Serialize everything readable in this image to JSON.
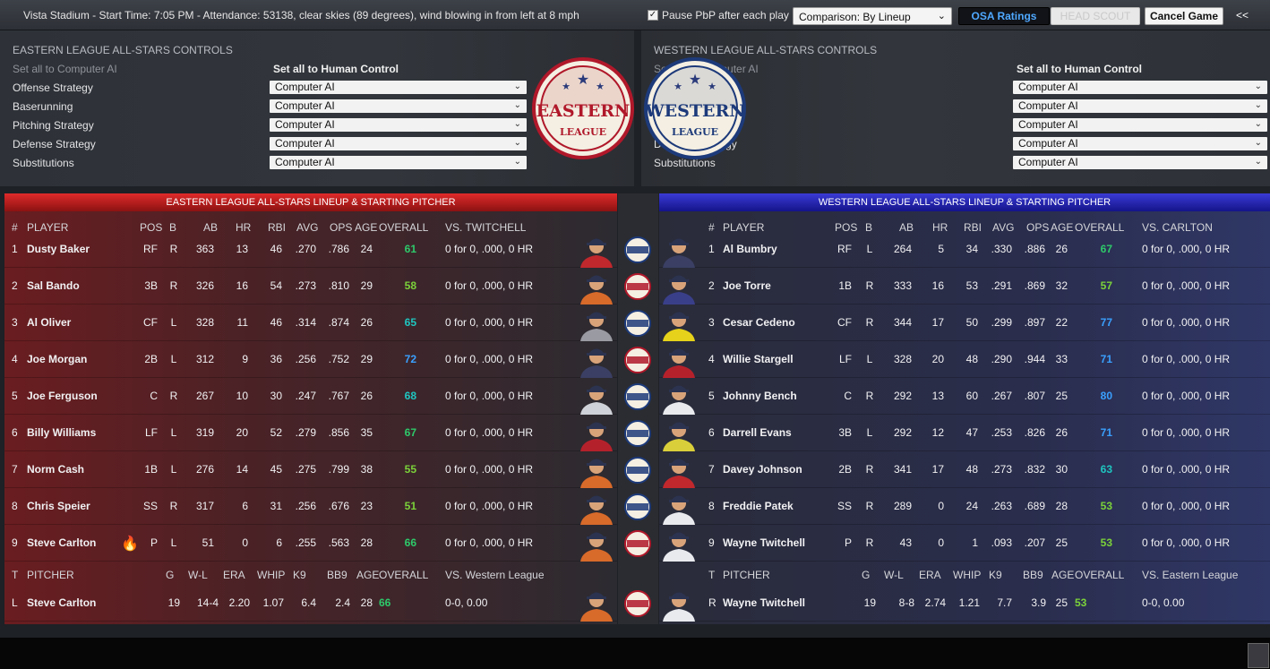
{
  "topbar": {
    "game_info": "Vista Stadium - Start Time: 7:05 PM - Attendance: 53138, clear skies (89 degrees), wind blowing in from left at 8 mph",
    "pause_label": "Pause PbP after each play",
    "pause_checked": true,
    "comparison_value": "Comparison: By Lineup",
    "osa_label": "OSA Ratings",
    "headscout_label": "HEAD SCOUT",
    "cancel_label": "Cancel Game",
    "collapse_label": "<<"
  },
  "eastern_controls": {
    "title": "EASTERN LEAGUE ALL-STARS CONTROLS",
    "set_ai": "Set all to Computer AI",
    "set_human": "Set all to Human Control",
    "rows": [
      {
        "label": "Offense Strategy",
        "value": "Computer AI"
      },
      {
        "label": "Baserunning",
        "value": "Computer AI"
      },
      {
        "label": "Pitching Strategy",
        "value": "Computer AI"
      },
      {
        "label": "Defense Strategy",
        "value": "Computer AI"
      },
      {
        "label": "Substitutions",
        "value": "Computer AI"
      }
    ]
  },
  "western_controls": {
    "title": "WESTERN LEAGUE ALL-STARS CONTROLS",
    "set_ai": "Set all to Computer AI",
    "set_human": "Set all to Human Control",
    "rows": [
      {
        "label": "Offense Strategy",
        "value": "Computer AI"
      },
      {
        "label": "Baserunning",
        "value": "Computer AI"
      },
      {
        "label": "Pitching Strategy",
        "value": "Computer AI"
      },
      {
        "label": "Defense Strategy",
        "value": "Computer AI"
      },
      {
        "label": "Substitutions",
        "value": "Computer AI"
      }
    ]
  },
  "logos": {
    "eastern": {
      "word": "EASTERN",
      "sub": "LEAGUE",
      "color": "#b0182a"
    },
    "western": {
      "word": "WESTERN",
      "sub": "LEAGUE",
      "color": "#1d3a7a"
    }
  },
  "eastern_lineup": {
    "title": "EASTERN LEAGUE ALL-STARS LINEUP & STARTING PITCHER",
    "headers": {
      "num": "#",
      "player": "PLAYER",
      "pos": "POS",
      "b": "B",
      "ab": "AB",
      "hr": "HR",
      "rbi": "RBI",
      "avg": "AVG",
      "ops": "OPS",
      "age": "AGE",
      "overall": "OVERALL",
      "vs": "VS. TWITCHELL"
    },
    "rows": [
      {
        "num": "1",
        "player": "Dusty Baker",
        "pos": "RF",
        "b": "R",
        "ab": "363",
        "hr": "13",
        "rbi": "46",
        "avg": ".270",
        "ops": ".786",
        "age": "24",
        "overall": "61",
        "ov": "g",
        "vs": "0 for 0, .000, 0 HR",
        "badge": "W",
        "jersey": "#c0282d"
      },
      {
        "num": "2",
        "player": "Sal Bando",
        "pos": "3B",
        "b": "R",
        "ab": "326",
        "hr": "16",
        "rbi": "54",
        "avg": ".273",
        "ops": ".810",
        "age": "29",
        "overall": "58",
        "ov": "l",
        "vs": "0 for 0, .000, 0 HR",
        "badge": "E",
        "jersey": "#d86a2a"
      },
      {
        "num": "3",
        "player": "Al Oliver",
        "pos": "CF",
        "b": "L",
        "ab": "328",
        "hr": "11",
        "rbi": "46",
        "avg": ".314",
        "ops": ".874",
        "age": "26",
        "overall": "65",
        "ov": "c",
        "vs": "0 for 0, .000, 0 HR",
        "badge": "W",
        "jersey": "#9a9aa2"
      },
      {
        "num": "4",
        "player": "Joe Morgan",
        "pos": "2B",
        "b": "L",
        "ab": "312",
        "hr": "9",
        "rbi": "36",
        "avg": ".256",
        "ops": ".752",
        "age": "29",
        "overall": "72",
        "ov": "b",
        "vs": "0 for 0, .000, 0 HR",
        "badge": "E",
        "jersey": "#3a3f63"
      },
      {
        "num": "5",
        "player": "Joe Ferguson",
        "pos": "C",
        "b": "R",
        "ab": "267",
        "hr": "10",
        "rbi": "30",
        "avg": ".247",
        "ops": ".767",
        "age": "26",
        "overall": "68",
        "ov": "c",
        "vs": "0 for 0, .000, 0 HR",
        "badge": "W",
        "jersey": "#cfd2d8"
      },
      {
        "num": "6",
        "player": "Billy Williams",
        "pos": "LF",
        "b": "L",
        "ab": "319",
        "hr": "20",
        "rbi": "52",
        "avg": ".279",
        "ops": ".856",
        "age": "35",
        "overall": "67",
        "ov": "g",
        "vs": "0 for 0, .000, 0 HR",
        "badge": "W",
        "jersey": "#b5212b"
      },
      {
        "num": "7",
        "player": "Norm Cash",
        "pos": "1B",
        "b": "L",
        "ab": "276",
        "hr": "14",
        "rbi": "45",
        "avg": ".275",
        "ops": ".799",
        "age": "38",
        "overall": "55",
        "ov": "l",
        "vs": "0 for 0, .000, 0 HR",
        "badge": "W",
        "jersey": "#d86a2a"
      },
      {
        "num": "8",
        "player": "Chris Speier",
        "pos": "SS",
        "b": "R",
        "ab": "317",
        "hr": "6",
        "rbi": "31",
        "avg": ".256",
        "ops": ".676",
        "age": "23",
        "overall": "51",
        "ov": "l",
        "vs": "0 for 0, .000, 0 HR",
        "badge": "W",
        "jersey": "#d86a2a"
      },
      {
        "num": "9",
        "player": "Steve Carlton",
        "pos": "P",
        "b": "L",
        "ab": "51",
        "hr": "0",
        "rbi": "6",
        "avg": ".255",
        "ops": ".563",
        "age": "28",
        "overall": "66",
        "ov": "g",
        "vs": "0 for 0, .000, 0 HR",
        "badge": "E",
        "jersey": "#d86a2a",
        "fire": true
      }
    ],
    "pitcher_headers": {
      "t": "T",
      "pitcher": "PITCHER",
      "g": "G",
      "wl": "W-L",
      "era": "ERA",
      "whip": "WHIP",
      "k9": "K9",
      "bb9": "BB9",
      "age": "AGE",
      "overall": "OVERALL",
      "vs": "VS. Western League"
    },
    "pitcher": {
      "t": "L",
      "name": "Steve Carlton",
      "g": "19",
      "wl": "14-4",
      "era": "2.20",
      "whip": "1.07",
      "k9": "6.4",
      "bb9": "2.4",
      "age": "28",
      "overall": "66",
      "ov": "g",
      "vs": "0-0, 0.00",
      "badge": "E",
      "jersey": "#d86a2a"
    }
  },
  "western_lineup": {
    "title": "WESTERN LEAGUE ALL-STARS LINEUP & STARTING PITCHER",
    "headers": {
      "num": "#",
      "player": "PLAYER",
      "pos": "POS",
      "b": "B",
      "ab": "AB",
      "hr": "HR",
      "rbi": "RBI",
      "avg": "AVG",
      "ops": "OPS",
      "age": "AGE",
      "overall": "OVERALL",
      "vs": "VS. CARLTON"
    },
    "rows": [
      {
        "num": "1",
        "player": "Al Bumbry",
        "pos": "RF",
        "b": "L",
        "ab": "264",
        "hr": "5",
        "rbi": "34",
        "avg": ".330",
        "ops": ".886",
        "age": "26",
        "overall": "67",
        "ov": "g",
        "vs": "0 for 0, .000, 0 HR",
        "jersey": "#3a3f63"
      },
      {
        "num": "2",
        "player": "Joe Torre",
        "pos": "1B",
        "b": "R",
        "ab": "333",
        "hr": "16",
        "rbi": "53",
        "avg": ".291",
        "ops": ".869",
        "age": "32",
        "overall": "57",
        "ov": "l",
        "vs": "0 for 0, .000, 0 HR",
        "jersey": "#3a3f8a"
      },
      {
        "num": "3",
        "player": "Cesar Cedeno",
        "pos": "CF",
        "b": "R",
        "ab": "344",
        "hr": "17",
        "rbi": "50",
        "avg": ".299",
        "ops": ".897",
        "age": "22",
        "overall": "77",
        "ov": "b",
        "vs": "0 for 0, .000, 0 HR",
        "jersey": "#e6d21a"
      },
      {
        "num": "4",
        "player": "Willie Stargell",
        "pos": "LF",
        "b": "L",
        "ab": "328",
        "hr": "20",
        "rbi": "48",
        "avg": ".290",
        "ops": ".944",
        "age": "33",
        "overall": "71",
        "ov": "b",
        "vs": "0 for 0, .000, 0 HR",
        "jersey": "#b5212b"
      },
      {
        "num": "5",
        "player": "Johnny Bench",
        "pos": "C",
        "b": "R",
        "ab": "292",
        "hr": "13",
        "rbi": "60",
        "avg": ".267",
        "ops": ".807",
        "age": "25",
        "overall": "80",
        "ov": "b",
        "vs": "0 for 0, .000, 0 HR",
        "jersey": "#e8eaee"
      },
      {
        "num": "6",
        "player": "Darrell Evans",
        "pos": "3B",
        "b": "L",
        "ab": "292",
        "hr": "12",
        "rbi": "47",
        "avg": ".253",
        "ops": ".826",
        "age": "26",
        "overall": "71",
        "ov": "b",
        "vs": "0 for 0, .000, 0 HR",
        "jersey": "#d9cf3a"
      },
      {
        "num": "7",
        "player": "Davey Johnson",
        "pos": "2B",
        "b": "R",
        "ab": "341",
        "hr": "17",
        "rbi": "48",
        "avg": ".273",
        "ops": ".832",
        "age": "30",
        "overall": "63",
        "ov": "c",
        "vs": "0 for 0, .000, 0 HR",
        "jersey": "#c0282d"
      },
      {
        "num": "8",
        "player": "Freddie Patek",
        "pos": "SS",
        "b": "R",
        "ab": "289",
        "hr": "0",
        "rbi": "24",
        "avg": ".263",
        "ops": ".689",
        "age": "28",
        "overall": "53",
        "ov": "l",
        "vs": "0 for 0, .000, 0 HR",
        "jersey": "#e8eaee"
      },
      {
        "num": "9",
        "player": "Wayne Twitchell",
        "pos": "P",
        "b": "R",
        "ab": "43",
        "hr": "0",
        "rbi": "1",
        "avg": ".093",
        "ops": ".207",
        "age": "25",
        "overall": "53",
        "ov": "l",
        "vs": "0 for 0, .000, 0 HR",
        "jersey": "#e8eaee"
      }
    ],
    "pitcher_headers": {
      "t": "T",
      "pitcher": "PITCHER",
      "g": "G",
      "wl": "W-L",
      "era": "ERA",
      "whip": "WHIP",
      "k9": "K9",
      "bb9": "BB9",
      "age": "AGE",
      "overall": "OVERALL",
      "vs": "VS. Eastern League"
    },
    "pitcher": {
      "t": "R",
      "name": "Wayne Twitchell",
      "g": "19",
      "wl": "8-8",
      "era": "2.74",
      "whip": "1.21",
      "k9": "7.7",
      "bb9": "3.9",
      "age": "25",
      "overall": "53",
      "ov": "l",
      "vs": "0-0, 0.00",
      "jersey": "#e8eaee"
    }
  }
}
